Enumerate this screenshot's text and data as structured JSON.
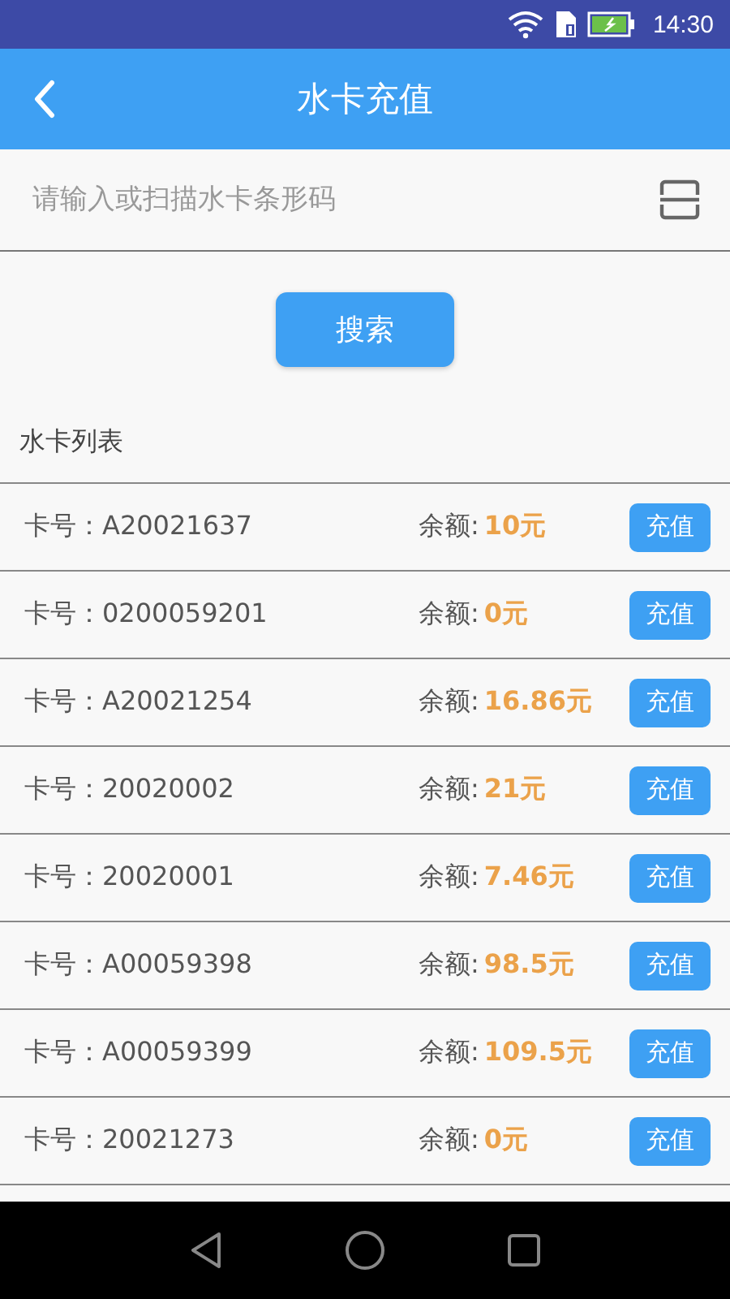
{
  "status_bar": {
    "time": "14:30"
  },
  "header": {
    "title": "水卡充值"
  },
  "search": {
    "placeholder": "请输入或扫描水卡条形码",
    "button": "搜索"
  },
  "list": {
    "title": "水卡列表",
    "rows": [
      {
        "card_label": "卡号：",
        "card_no": "A20021637",
        "balance_label": "余额:",
        "balance": "10元",
        "button": "充值"
      },
      {
        "card_label": "卡号：",
        "card_no": "0200059201",
        "balance_label": "余额:",
        "balance": "0元",
        "button": "充值"
      },
      {
        "card_label": "卡号：",
        "card_no": "A20021254",
        "balance_label": "余额:",
        "balance": "16.86元",
        "button": "充值"
      },
      {
        "card_label": "卡号：",
        "card_no": "20020002",
        "balance_label": "余额:",
        "balance": "21元",
        "button": "充值"
      },
      {
        "card_label": "卡号：",
        "card_no": "20020001",
        "balance_label": "余额:",
        "balance": "7.46元",
        "button": "充值"
      },
      {
        "card_label": "卡号：",
        "card_no": "A00059398",
        "balance_label": "余额:",
        "balance": "98.5元",
        "button": "充值"
      },
      {
        "card_label": "卡号：",
        "card_no": "A00059399",
        "balance_label": "余额:",
        "balance": "109.5元",
        "button": "充值"
      },
      {
        "card_label": "卡号：",
        "card_no": "20021273",
        "balance_label": "余额:",
        "balance": "0元",
        "button": "充值"
      }
    ]
  }
}
